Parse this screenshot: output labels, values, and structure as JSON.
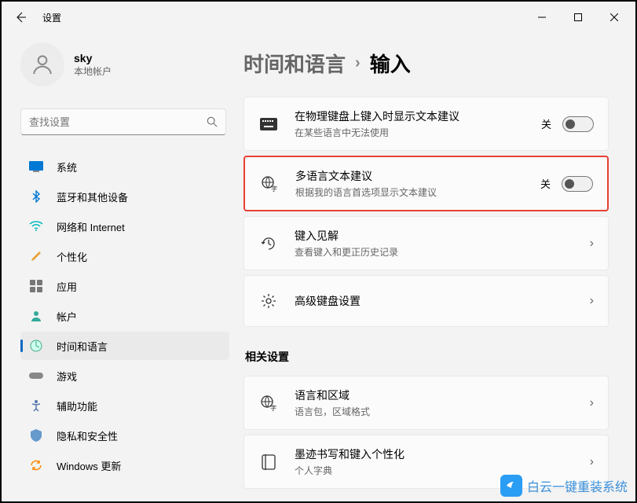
{
  "title": "设置",
  "user": {
    "name": "sky",
    "type": "本地帐户"
  },
  "search": {
    "placeholder": "查找设置"
  },
  "nav": [
    {
      "label": "系统"
    },
    {
      "label": "蓝牙和其他设备"
    },
    {
      "label": "网络和 Internet"
    },
    {
      "label": "个性化"
    },
    {
      "label": "应用"
    },
    {
      "label": "帐户"
    },
    {
      "label": "时间和语言"
    },
    {
      "label": "游戏"
    },
    {
      "label": "辅助功能"
    },
    {
      "label": "隐私和安全性"
    },
    {
      "label": "Windows 更新"
    }
  ],
  "breadcrumb": {
    "parent": "时间和语言",
    "current": "输入"
  },
  "cards": {
    "physKbd": {
      "title": "在物理键盘上键入时显示文本建议",
      "sub": "在某些语言中无法使用",
      "state": "关"
    },
    "multiLang": {
      "title": "多语言文本建议",
      "sub": "根据我的语言首选项显示文本建议",
      "state": "关"
    },
    "insights": {
      "title": "键入见解",
      "sub": "查看键入和更正历史记录"
    },
    "advKbd": {
      "title": "高级键盘设置"
    }
  },
  "related": {
    "header": "相关设置",
    "langRegion": {
      "title": "语言和区域",
      "sub": "语言包，区域格式"
    },
    "ink": {
      "title": "墨迹书写和键入个性化",
      "sub": "个人字典"
    }
  },
  "watermark": "白云一键重装系统"
}
